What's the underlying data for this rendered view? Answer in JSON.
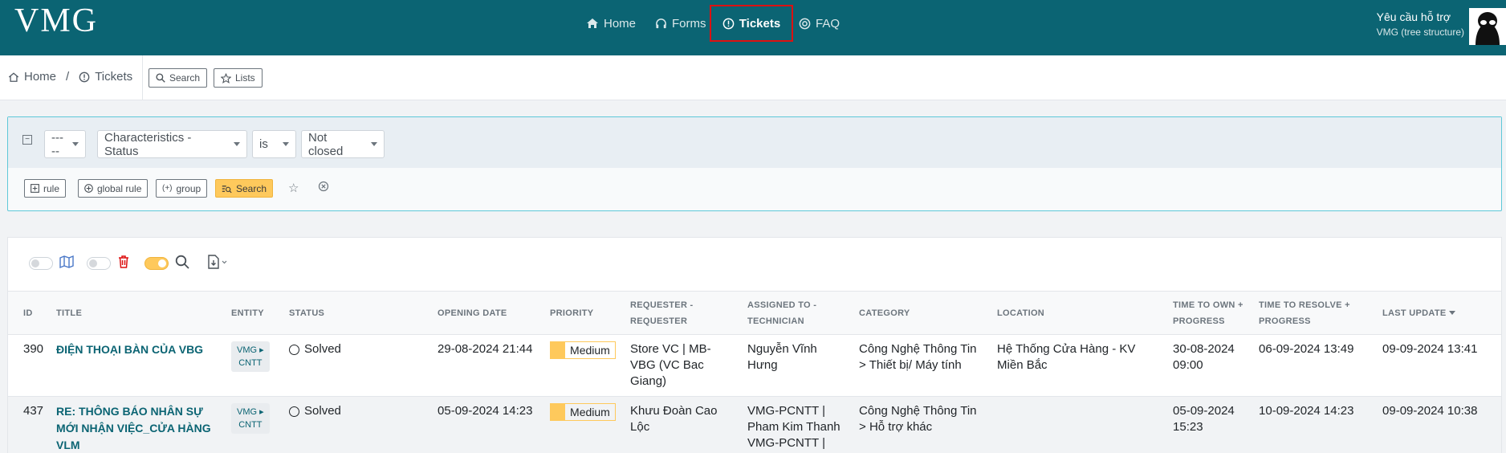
{
  "app": {
    "logo": "VMG"
  },
  "nav": {
    "home": "Home",
    "forms": "Forms",
    "tickets": "Tickets",
    "faq": "FAQ"
  },
  "user": {
    "title": "Yêu cầu hỗ trợ",
    "subtitle": "VMG (tree structure)"
  },
  "breadcrumb": {
    "home": "Home",
    "separator": "/",
    "current": "Tickets"
  },
  "crumb_actions": {
    "search": "Search",
    "lists": "Lists"
  },
  "filter": {
    "field_prefix": "-----",
    "field": "Characteristics - Status",
    "operator": "is",
    "value": "Not closed",
    "buttons": {
      "rule": "rule",
      "global_rule": "global rule",
      "group": "group",
      "search": "Search"
    }
  },
  "table": {
    "headers": {
      "id": "ID",
      "title": "TITLE",
      "entity": "ENTITY",
      "status": "STATUS",
      "opening_date": "OPENING DATE",
      "priority": "PRIORITY",
      "requester": "REQUESTER - REQUESTER",
      "assigned": "ASSIGNED TO - TECHNICIAN",
      "category": "CATEGORY",
      "location": "LOCATION",
      "time_to_own": "TIME TO OWN + PROGRESS",
      "time_to_resolve": "TIME TO RESOLVE + PROGRESS",
      "last_update": "LAST UPDATE"
    },
    "rows": [
      {
        "id": "390",
        "title": "ĐIỆN THOẠI BÀN CỦA VBG",
        "entity_1": "VMG",
        "entity_2": "CNTT",
        "status": "Solved",
        "opening_date": "29-08-2024 21:44",
        "priority": "Medium",
        "requester": "Store VC | MB-VBG (VC Bac Giang)",
        "assigned": "Nguyễn Vĩnh Hưng",
        "category": "Công Nghệ Thông Tin > Thiết bị/ Máy tính",
        "location": "Hệ Thống Cửa Hàng - KV Miền Bắc",
        "time_to_own": "30-08-2024 09:00",
        "time_to_resolve": "06-09-2024 13:49",
        "last_update": "09-09-2024 13:41"
      },
      {
        "id": "437",
        "title": "RE: THÔNG BÁO NHÂN SỰ MỚI NHẬN VIỆC_CỬA HÀNG VLM",
        "entity_1": "VMG",
        "entity_2": "CNTT",
        "status": "Solved",
        "opening_date": "05-09-2024 14:23",
        "priority": "Medium",
        "requester": "Khưu Đoàn Cao Lộc",
        "assigned": "VMG-PCNTT | Pham Kim Thanh VMG-PCNTT | Tran T Binh Nhi",
        "category": "Công Nghệ Thông Tin > Hỗ trợ khác",
        "location": "",
        "time_to_own": "05-09-2024 15:23",
        "time_to_resolve": "10-09-2024 14:23",
        "last_update": "09-09-2024 10:38"
      }
    ]
  },
  "colors": {
    "brand": "#0b6473",
    "accent": "#fec95c",
    "highlight": "#dd1111"
  }
}
